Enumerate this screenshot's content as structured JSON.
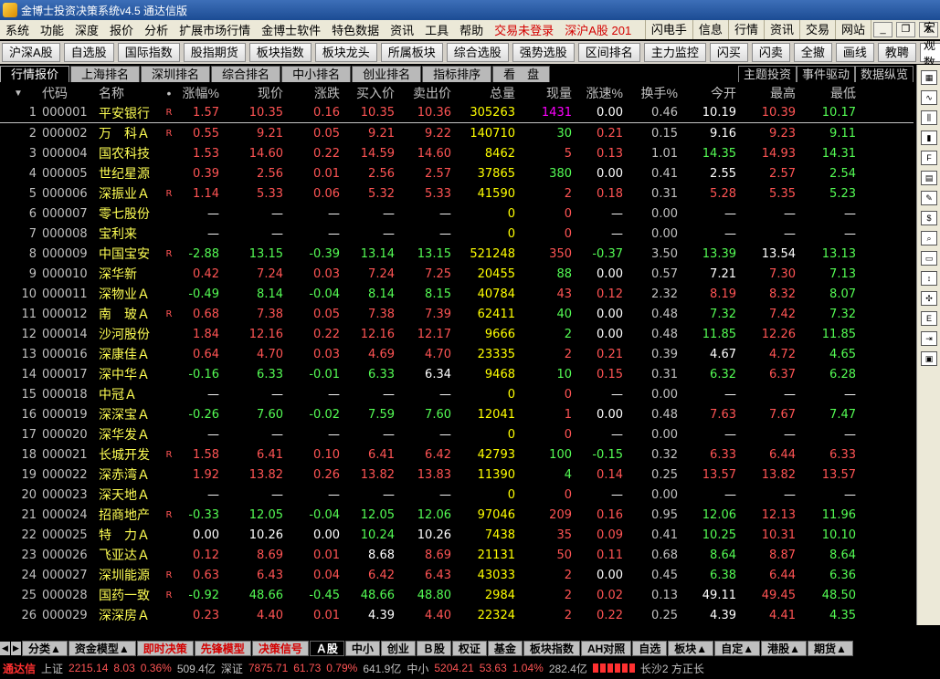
{
  "window": {
    "title": "金博士投资决策系统v4.5 通达信版"
  },
  "menu": {
    "items": [
      "系统",
      "功能",
      "深度",
      "报价",
      "分析",
      "扩展市场行情",
      "金博士软件",
      "特色数据",
      "资讯",
      "工具",
      "帮助"
    ],
    "login": "交易未登录",
    "market": "深沪A股",
    "market_code": "201",
    "right": [
      "闪电手",
      "信息",
      "行情",
      "资讯",
      "交易",
      "网站"
    ]
  },
  "toolbar": {
    "buttons": [
      "沪深A股",
      "自选股",
      "国际指数",
      "股指期货",
      "板块指数",
      "板块龙头",
      "所属板块",
      "综合选股",
      "强势选股",
      "区间排名",
      "主力监控",
      "闪买",
      "闪卖",
      "全撤",
      "画线",
      "教聘"
    ],
    "select_value": "宏观数据"
  },
  "tabs": {
    "items": [
      "行情报价",
      "上海排名",
      "深圳排名",
      "综合排名",
      "中小排名",
      "创业排名",
      "指标排序",
      "看　盘"
    ],
    "right": [
      "主题投资",
      "事件驱动",
      "数据纵览"
    ]
  },
  "grid": {
    "headers": {
      "code": "代码",
      "name": "名称",
      "dot": "•",
      "chg_pct": "涨幅%",
      "price": "现价",
      "chg": "涨跌",
      "bid": "买入价",
      "ask": "卖出价",
      "vol": "总量",
      "cur": "现量",
      "speed": "涨速%",
      "turn": "换手%",
      "open": "今开",
      "high": "最高",
      "low": "最低"
    },
    "rows": [
      {
        "idx": "1",
        "code": "000001",
        "name": "平安银行",
        "flag": "R",
        "chg_pct": "1.57",
        "price": "10.35",
        "chg": "0.16",
        "bid": "10.35",
        "ask": "10.36",
        "vol": "305263",
        "cur": "1431",
        "speed": "0.00",
        "turn": "0.46",
        "open": "10.19",
        "high": "10.39",
        "low": "10.17",
        "c": [
          "up",
          "up",
          "up",
          "up",
          "up",
          "vol",
          "hv",
          "nc",
          "gy",
          "nc",
          "up",
          "dn"
        ]
      },
      {
        "idx": "2",
        "code": "000002",
        "name": "万　科Ａ",
        "flag": "R",
        "chg_pct": "0.55",
        "price": "9.21",
        "chg": "0.05",
        "bid": "9.21",
        "ask": "9.22",
        "vol": "140710",
        "cur": "30",
        "speed": "0.21",
        "turn": "0.15",
        "open": "9.16",
        "high": "9.23",
        "low": "9.11",
        "c": [
          "up",
          "up",
          "up",
          "up",
          "up",
          "vol",
          "dn",
          "up",
          "gy",
          "nc",
          "up",
          "dn"
        ]
      },
      {
        "idx": "3",
        "code": "000004",
        "name": "国农科技",
        "flag": "",
        "chg_pct": "1.53",
        "price": "14.60",
        "chg": "0.22",
        "bid": "14.59",
        "ask": "14.60",
        "vol": "8462",
        "cur": "5",
        "speed": "0.13",
        "turn": "1.01",
        "open": "14.35",
        "high": "14.93",
        "low": "14.31",
        "c": [
          "up",
          "up",
          "up",
          "up",
          "up",
          "vol",
          "up",
          "up",
          "gy",
          "dn",
          "up",
          "dn"
        ]
      },
      {
        "idx": "4",
        "code": "000005",
        "name": "世纪星源",
        "flag": "",
        "chg_pct": "0.39",
        "price": "2.56",
        "chg": "0.01",
        "bid": "2.56",
        "ask": "2.57",
        "vol": "37865",
        "cur": "380",
        "speed": "0.00",
        "turn": "0.41",
        "open": "2.55",
        "high": "2.57",
        "low": "2.54",
        "c": [
          "up",
          "up",
          "up",
          "up",
          "up",
          "vol",
          "dn",
          "nc",
          "gy",
          "nc",
          "up",
          "dn"
        ]
      },
      {
        "idx": "5",
        "code": "000006",
        "name": "深振业Ａ",
        "flag": "R",
        "chg_pct": "1.14",
        "price": "5.33",
        "chg": "0.06",
        "bid": "5.32",
        "ask": "5.33",
        "vol": "41590",
        "cur": "2",
        "speed": "0.18",
        "turn": "0.31",
        "open": "5.28",
        "high": "5.35",
        "low": "5.23",
        "c": [
          "up",
          "up",
          "up",
          "up",
          "up",
          "vol",
          "up",
          "up",
          "gy",
          "up",
          "up",
          "dn"
        ]
      },
      {
        "idx": "6",
        "code": "000007",
        "name": "零七股份",
        "flag": "",
        "chg_pct": "—",
        "price": "—",
        "chg": "—",
        "bid": "—",
        "ask": "—",
        "vol": "0",
        "cur": "0",
        "speed": "—",
        "turn": "0.00",
        "open": "—",
        "high": "—",
        "low": "—",
        "c": [
          "nc",
          "nc",
          "nc",
          "nc",
          "nc",
          "vol",
          "up",
          "nc",
          "gy",
          "nc",
          "nc",
          "nc"
        ]
      },
      {
        "idx": "7",
        "code": "000008",
        "name": "宝利来",
        "flag": "",
        "chg_pct": "—",
        "price": "—",
        "chg": "—",
        "bid": "—",
        "ask": "—",
        "vol": "0",
        "cur": "0",
        "speed": "—",
        "turn": "0.00",
        "open": "—",
        "high": "—",
        "low": "—",
        "c": [
          "nc",
          "nc",
          "nc",
          "nc",
          "nc",
          "vol",
          "up",
          "nc",
          "gy",
          "nc",
          "nc",
          "nc"
        ]
      },
      {
        "idx": "8",
        "code": "000009",
        "name": "中国宝安",
        "flag": "R",
        "chg_pct": "-2.88",
        "price": "13.15",
        "chg": "-0.39",
        "bid": "13.14",
        "ask": "13.15",
        "vol": "521248",
        "cur": "350",
        "speed": "-0.37",
        "turn": "3.50",
        "open": "13.39",
        "high": "13.54",
        "low": "13.13",
        "c": [
          "dn",
          "dn",
          "dn",
          "dn",
          "dn",
          "vol",
          "up",
          "dn",
          "gy",
          "dn",
          "nc",
          "dn"
        ]
      },
      {
        "idx": "9",
        "code": "000010",
        "name": "深华新",
        "flag": "",
        "chg_pct": "0.42",
        "price": "7.24",
        "chg": "0.03",
        "bid": "7.24",
        "ask": "7.25",
        "vol": "20455",
        "cur": "88",
        "speed": "0.00",
        "turn": "0.57",
        "open": "7.21",
        "high": "7.30",
        "low": "7.13",
        "c": [
          "up",
          "up",
          "up",
          "up",
          "up",
          "vol",
          "dn",
          "nc",
          "gy",
          "nc",
          "up",
          "dn"
        ]
      },
      {
        "idx": "10",
        "code": "000011",
        "name": "深物业Ａ",
        "flag": "",
        "chg_pct": "-0.49",
        "price": "8.14",
        "chg": "-0.04",
        "bid": "8.14",
        "ask": "8.15",
        "vol": "40784",
        "cur": "43",
        "speed": "0.12",
        "turn": "2.32",
        "open": "8.19",
        "high": "8.32",
        "low": "8.07",
        "c": [
          "dn",
          "dn",
          "dn",
          "dn",
          "dn",
          "vol",
          "up",
          "up",
          "gy",
          "up",
          "up",
          "dn"
        ]
      },
      {
        "idx": "11",
        "code": "000012",
        "name": "南　玻Ａ",
        "flag": "R",
        "chg_pct": "0.68",
        "price": "7.38",
        "chg": "0.05",
        "bid": "7.38",
        "ask": "7.39",
        "vol": "62411",
        "cur": "40",
        "speed": "0.00",
        "turn": "0.48",
        "open": "7.32",
        "high": "7.42",
        "low": "7.32",
        "c": [
          "up",
          "up",
          "up",
          "up",
          "up",
          "vol",
          "dn",
          "nc",
          "gy",
          "dn",
          "up",
          "dn"
        ]
      },
      {
        "idx": "12",
        "code": "000014",
        "name": "沙河股份",
        "flag": "",
        "chg_pct": "1.84",
        "price": "12.16",
        "chg": "0.22",
        "bid": "12.16",
        "ask": "12.17",
        "vol": "9666",
        "cur": "2",
        "speed": "0.00",
        "turn": "0.48",
        "open": "11.85",
        "high": "12.26",
        "low": "11.85",
        "c": [
          "up",
          "up",
          "up",
          "up",
          "up",
          "vol",
          "dn",
          "nc",
          "gy",
          "dn",
          "up",
          "dn"
        ]
      },
      {
        "idx": "13",
        "code": "000016",
        "name": "深康佳Ａ",
        "flag": "",
        "chg_pct": "0.64",
        "price": "4.70",
        "chg": "0.03",
        "bid": "4.69",
        "ask": "4.70",
        "vol": "23335",
        "cur": "2",
        "speed": "0.21",
        "turn": "0.39",
        "open": "4.67",
        "high": "4.72",
        "low": "4.65",
        "c": [
          "up",
          "up",
          "up",
          "up",
          "up",
          "vol",
          "up",
          "up",
          "gy",
          "nc",
          "up",
          "dn"
        ]
      },
      {
        "idx": "14",
        "code": "000017",
        "name": "深中华Ａ",
        "flag": "",
        "chg_pct": "-0.16",
        "price": "6.33",
        "chg": "-0.01",
        "bid": "6.33",
        "ask": "6.34",
        "vol": "9468",
        "cur": "10",
        "speed": "0.15",
        "turn": "0.31",
        "open": "6.32",
        "high": "6.37",
        "low": "6.28",
        "c": [
          "dn",
          "dn",
          "dn",
          "dn",
          "nc",
          "vol",
          "dn",
          "up",
          "gy",
          "dn",
          "up",
          "dn"
        ]
      },
      {
        "idx": "15",
        "code": "000018",
        "name": "中冠Ａ",
        "flag": "",
        "chg_pct": "—",
        "price": "—",
        "chg": "—",
        "bid": "—",
        "ask": "—",
        "vol": "0",
        "cur": "0",
        "speed": "—",
        "turn": "0.00",
        "open": "—",
        "high": "—",
        "low": "—",
        "c": [
          "nc",
          "nc",
          "nc",
          "nc",
          "nc",
          "vol",
          "up",
          "nc",
          "gy",
          "nc",
          "nc",
          "nc"
        ]
      },
      {
        "idx": "16",
        "code": "000019",
        "name": "深深宝Ａ",
        "flag": "",
        "chg_pct": "-0.26",
        "price": "7.60",
        "chg": "-0.02",
        "bid": "7.59",
        "ask": "7.60",
        "vol": "12041",
        "cur": "1",
        "speed": "0.00",
        "turn": "0.48",
        "open": "7.63",
        "high": "7.67",
        "low": "7.47",
        "c": [
          "dn",
          "dn",
          "dn",
          "dn",
          "dn",
          "vol",
          "up",
          "nc",
          "gy",
          "up",
          "up",
          "dn"
        ]
      },
      {
        "idx": "17",
        "code": "000020",
        "name": "深华发Ａ",
        "flag": "",
        "chg_pct": "—",
        "price": "—",
        "chg": "—",
        "bid": "—",
        "ask": "—",
        "vol": "0",
        "cur": "0",
        "speed": "—",
        "turn": "0.00",
        "open": "—",
        "high": "—",
        "low": "—",
        "c": [
          "nc",
          "nc",
          "nc",
          "nc",
          "nc",
          "vol",
          "up",
          "nc",
          "gy",
          "nc",
          "nc",
          "nc"
        ]
      },
      {
        "idx": "18",
        "code": "000021",
        "name": "长城开发",
        "flag": "R",
        "chg_pct": "1.58",
        "price": "6.41",
        "chg": "0.10",
        "bid": "6.41",
        "ask": "6.42",
        "vol": "42793",
        "cur": "100",
        "speed": "-0.15",
        "turn": "0.32",
        "open": "6.33",
        "high": "6.44",
        "low": "6.33",
        "c": [
          "up",
          "up",
          "up",
          "up",
          "up",
          "vol",
          "dn",
          "dn",
          "gy",
          "up",
          "up",
          "up"
        ]
      },
      {
        "idx": "19",
        "code": "000022",
        "name": "深赤湾Ａ",
        "flag": "",
        "chg_pct": "1.92",
        "price": "13.82",
        "chg": "0.26",
        "bid": "13.82",
        "ask": "13.83",
        "vol": "11390",
        "cur": "4",
        "speed": "0.14",
        "turn": "0.25",
        "open": "13.57",
        "high": "13.82",
        "low": "13.57",
        "c": [
          "up",
          "up",
          "up",
          "up",
          "up",
          "vol",
          "dn",
          "up",
          "gy",
          "up",
          "up",
          "up"
        ]
      },
      {
        "idx": "20",
        "code": "000023",
        "name": "深天地Ａ",
        "flag": "",
        "chg_pct": "—",
        "price": "—",
        "chg": "—",
        "bid": "—",
        "ask": "—",
        "vol": "0",
        "cur": "0",
        "speed": "—",
        "turn": "0.00",
        "open": "—",
        "high": "—",
        "low": "—",
        "c": [
          "nc",
          "nc",
          "nc",
          "nc",
          "nc",
          "vol",
          "up",
          "nc",
          "gy",
          "nc",
          "nc",
          "nc"
        ]
      },
      {
        "idx": "21",
        "code": "000024",
        "name": "招商地产",
        "flag": "R",
        "chg_pct": "-0.33",
        "price": "12.05",
        "chg": "-0.04",
        "bid": "12.05",
        "ask": "12.06",
        "vol": "97046",
        "cur": "209",
        "speed": "0.16",
        "turn": "0.95",
        "open": "12.06",
        "high": "12.13",
        "low": "11.96",
        "c": [
          "dn",
          "dn",
          "dn",
          "dn",
          "dn",
          "vol",
          "up",
          "up",
          "gy",
          "dn",
          "up",
          "dn"
        ]
      },
      {
        "idx": "22",
        "code": "000025",
        "name": "特　力Ａ",
        "flag": "",
        "chg_pct": "0.00",
        "price": "10.26",
        "chg": "0.00",
        "bid": "10.24",
        "ask": "10.26",
        "vol": "7438",
        "cur": "35",
        "speed": "0.09",
        "turn": "0.41",
        "open": "10.25",
        "high": "10.31",
        "low": "10.10",
        "c": [
          "nc",
          "nc",
          "nc",
          "dn",
          "nc",
          "vol",
          "up",
          "up",
          "gy",
          "dn",
          "up",
          "dn"
        ]
      },
      {
        "idx": "23",
        "code": "000026",
        "name": "飞亚达Ａ",
        "flag": "",
        "chg_pct": "0.12",
        "price": "8.69",
        "chg": "0.01",
        "bid": "8.68",
        "ask": "8.69",
        "vol": "21131",
        "cur": "50",
        "speed": "0.11",
        "turn": "0.68",
        "open": "8.64",
        "high": "8.87",
        "low": "8.64",
        "c": [
          "up",
          "up",
          "up",
          "nc",
          "up",
          "vol",
          "up",
          "up",
          "gy",
          "dn",
          "up",
          "dn"
        ]
      },
      {
        "idx": "24",
        "code": "000027",
        "name": "深圳能源",
        "flag": "R",
        "chg_pct": "0.63",
        "price": "6.43",
        "chg": "0.04",
        "bid": "6.42",
        "ask": "6.43",
        "vol": "43033",
        "cur": "2",
        "speed": "0.00",
        "turn": "0.45",
        "open": "6.38",
        "high": "6.44",
        "low": "6.36",
        "c": [
          "up",
          "up",
          "up",
          "up",
          "up",
          "vol",
          "up",
          "nc",
          "gy",
          "dn",
          "up",
          "dn"
        ]
      },
      {
        "idx": "25",
        "code": "000028",
        "name": "国药一致",
        "flag": "R",
        "chg_pct": "-0.92",
        "price": "48.66",
        "chg": "-0.45",
        "bid": "48.66",
        "ask": "48.80",
        "vol": "2984",
        "cur": "2",
        "speed": "0.02",
        "turn": "0.13",
        "open": "49.11",
        "high": "49.45",
        "low": "48.50",
        "c": [
          "dn",
          "dn",
          "dn",
          "dn",
          "dn",
          "vol",
          "up",
          "up",
          "gy",
          "nc",
          "up",
          "dn"
        ]
      },
      {
        "idx": "26",
        "code": "000029",
        "name": "深深房Ａ",
        "flag": "",
        "chg_pct": "0.23",
        "price": "4.40",
        "chg": "0.01",
        "bid": "4.39",
        "ask": "4.40",
        "vol": "22324",
        "cur": "2",
        "speed": "0.22",
        "turn": "0.25",
        "open": "4.39",
        "high": "4.41",
        "low": "4.35",
        "c": [
          "up",
          "up",
          "up",
          "nc",
          "up",
          "vol",
          "up",
          "up",
          "gy",
          "nc",
          "up",
          "dn"
        ]
      }
    ]
  },
  "bottom_tabs": [
    {
      "label": "分类▲",
      "style": ""
    },
    {
      "label": "资金模型▲",
      "style": ""
    },
    {
      "label": "即时决策",
      "style": "red"
    },
    {
      "label": "先锋模型",
      "style": "red"
    },
    {
      "label": "决策信号",
      "style": "red"
    },
    {
      "label": "Ａ股",
      "style": "active"
    },
    {
      "label": "中小",
      "style": ""
    },
    {
      "label": "创业",
      "style": ""
    },
    {
      "label": "Ｂ股",
      "style": ""
    },
    {
      "label": "权证",
      "style": ""
    },
    {
      "label": "基金",
      "style": ""
    },
    {
      "label": "板块指数",
      "style": ""
    },
    {
      "label": "AH对照",
      "style": ""
    },
    {
      "label": "自选",
      "style": ""
    },
    {
      "label": "板块▲",
      "style": ""
    },
    {
      "label": "自定▲",
      "style": ""
    },
    {
      "label": "港股▲",
      "style": ""
    },
    {
      "label": "期货▲",
      "style": ""
    }
  ],
  "status": {
    "brand": "通达信",
    "sh_label": "上证",
    "sh_index": "2215.14",
    "sh_chg": "8.03",
    "sh_pct": "0.36%",
    "sh_amt": "509.4亿",
    "sz_label": "深证",
    "sz_index": "7875.71",
    "sz_chg": "61.73",
    "sz_pct": "0.79%",
    "sz_amt": "641.9亿",
    "zx_label": "中小",
    "zx_index": "5204.21",
    "zx_chg": "53.63",
    "zx_pct": "1.04%",
    "zx_amt": "282.4亿",
    "ticker": "长沙2 方正长"
  },
  "colors": {
    "up": "#ff5454",
    "down": "#54fc54",
    "flat": "#ffffff",
    "volume": "#ffff00",
    "name": "#ffff54",
    "highlight": "#ff00ff"
  }
}
